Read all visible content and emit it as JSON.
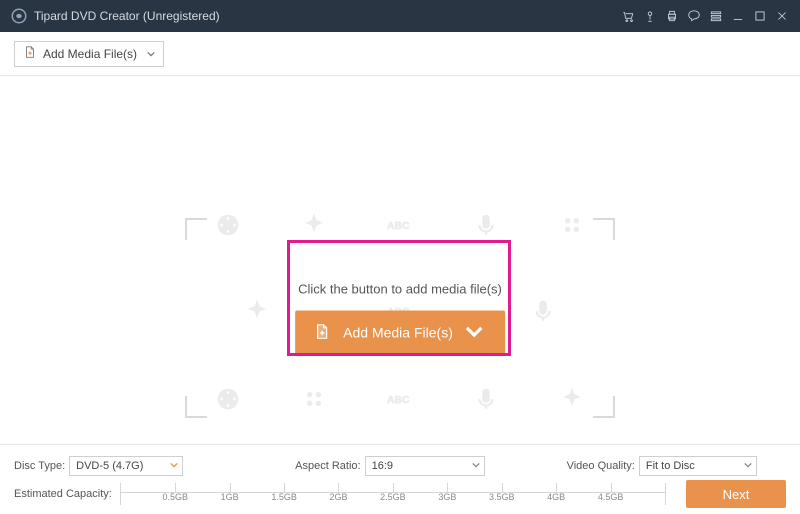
{
  "titlebar": {
    "title": "Tipard DVD Creator (Unregistered)"
  },
  "topbar": {
    "add_label": "Add Media File(s)"
  },
  "main": {
    "instruction": "Click the button to add media file(s)",
    "add_big_label": "Add Media File(s)",
    "watermark_text": "ABC"
  },
  "footer": {
    "disc_type_label": "Disc Type:",
    "disc_type_value": "DVD-5 (4.7G)",
    "aspect_ratio_label": "Aspect Ratio:",
    "aspect_ratio_value": "16:9",
    "video_quality_label": "Video Quality:",
    "video_quality_value": "Fit to Disc",
    "capacity_label": "Estimated Capacity:",
    "next_label": "Next",
    "ticks": [
      "0.5GB",
      "1GB",
      "1.5GB",
      "2GB",
      "2.5GB",
      "3GB",
      "3.5GB",
      "4GB",
      "4.5GB"
    ]
  },
  "colors": {
    "accent": "#e9924b",
    "highlight": "#e11b8f",
    "titlebar": "#2a3544"
  }
}
